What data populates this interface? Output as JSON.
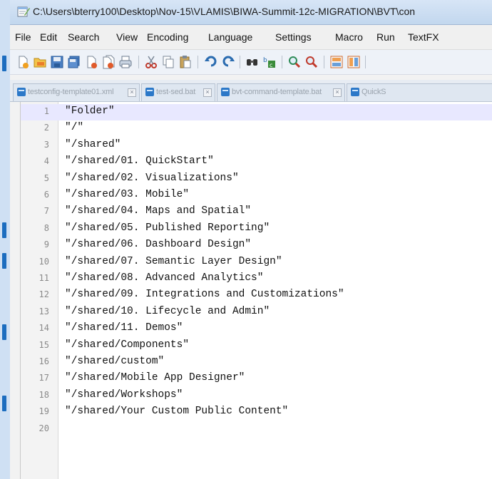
{
  "window": {
    "title": "C:\\Users\\bterry100\\Desktop\\Nov-15\\VLAMIS\\BIWA-Summit-12c-MIGRATION\\BVT\\con"
  },
  "menu": {
    "items": [
      "File",
      "Edit",
      "Search",
      "View",
      "Encoding",
      "Language",
      "Settings",
      "Macro",
      "Run",
      "TextFX"
    ]
  },
  "toolbar": {
    "icons": [
      "new-file-icon",
      "open-file-icon",
      "save-icon",
      "save-all-icon",
      "close-icon",
      "close-all-icon",
      "print-icon",
      "cut-icon",
      "copy-icon",
      "paste-icon",
      "undo-icon",
      "redo-icon",
      "find-icon",
      "replace-icon",
      "zoom-in-icon",
      "zoom-out-icon",
      "sync-vertical-icon",
      "sync-horizontal-icon"
    ]
  },
  "tabs": [
    {
      "label": "testconfig-template01.xml"
    },
    {
      "label": "test-sed.bat"
    },
    {
      "label": "bvt-command-template.bat"
    },
    {
      "label": "QuickS"
    }
  ],
  "editor": {
    "lines": [
      {
        "n": "1",
        "text": "\"Folder\""
      },
      {
        "n": "2",
        "text": "\"/\""
      },
      {
        "n": "3",
        "text": "\"/shared\""
      },
      {
        "n": "4",
        "text": "\"/shared/01. QuickStart\""
      },
      {
        "n": "5",
        "text": "\"/shared/02. Visualizations\""
      },
      {
        "n": "6",
        "text": "\"/shared/03. Mobile\""
      },
      {
        "n": "7",
        "text": "\"/shared/04. Maps and Spatial\""
      },
      {
        "n": "8",
        "text": "\"/shared/05. Published Reporting\""
      },
      {
        "n": "9",
        "text": "\"/shared/06. Dashboard Design\""
      },
      {
        "n": "10",
        "text": "\"/shared/07. Semantic Layer Design\""
      },
      {
        "n": "11",
        "text": "\"/shared/08. Advanced Analytics\""
      },
      {
        "n": "12",
        "text": "\"/shared/09. Integrations and Customizations\""
      },
      {
        "n": "13",
        "text": "\"/shared/10. Lifecycle and Admin\""
      },
      {
        "n": "14",
        "text": "\"/shared/11. Demos\""
      },
      {
        "n": "15",
        "text": "\"/shared/Components\""
      },
      {
        "n": "16",
        "text": "\"/shared/custom\""
      },
      {
        "n": "17",
        "text": "\"/shared/Mobile App Designer\""
      },
      {
        "n": "18",
        "text": "\"/shared/Workshops\""
      },
      {
        "n": "19",
        "text": "\"/shared/Your Custom Public Content\""
      },
      {
        "n": "20",
        "text": ""
      }
    ]
  }
}
